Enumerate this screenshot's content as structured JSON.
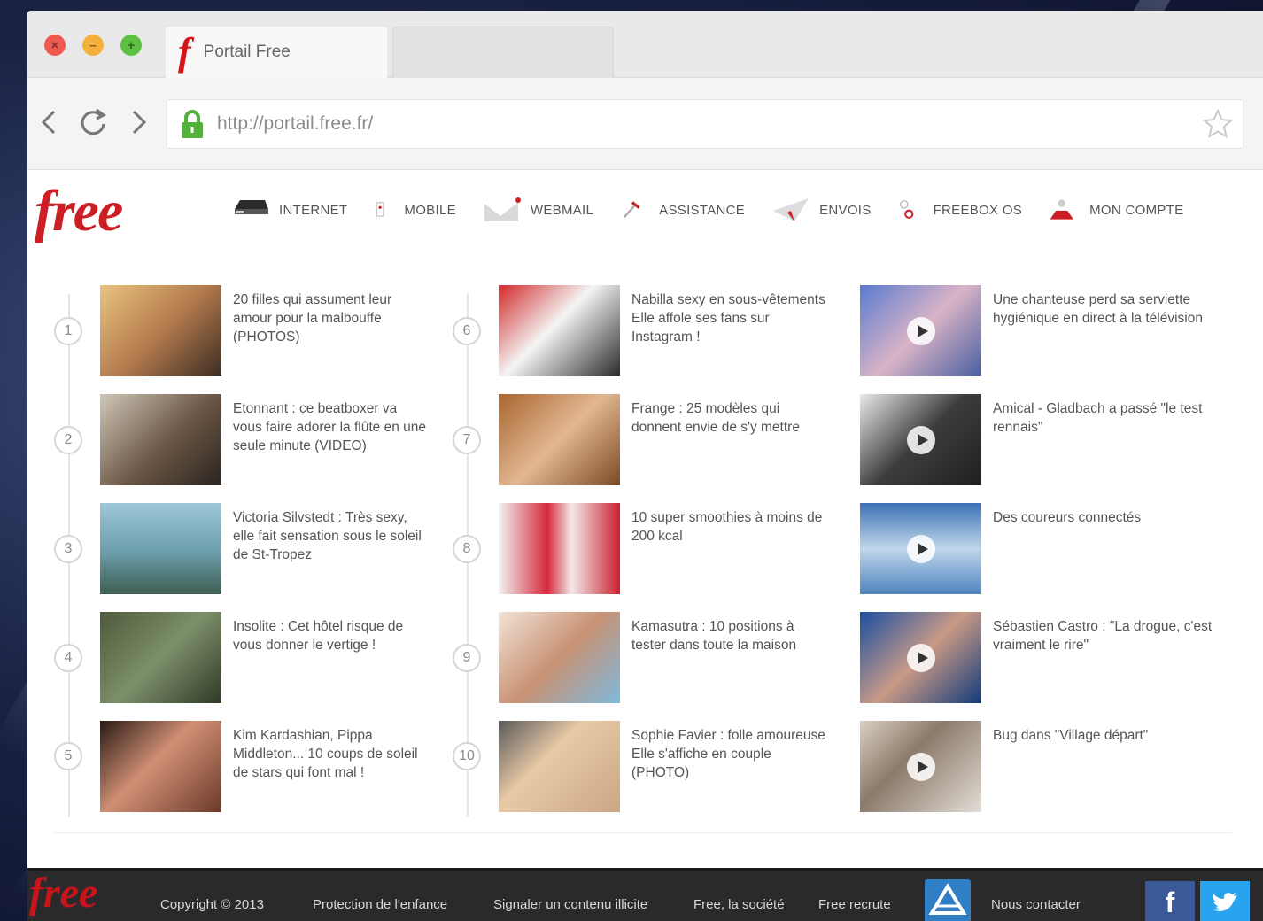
{
  "browser": {
    "tabs": [
      {
        "label": "Portail Free",
        "active": true
      },
      {
        "label": "",
        "active": false
      }
    ],
    "url": "http://portail.free.fr/"
  },
  "site": {
    "logo": "free",
    "nav": [
      {
        "label": "INTERNET",
        "icon": "freebox-icon"
      },
      {
        "label": "MOBILE",
        "icon": "mobile-icon"
      },
      {
        "label": "WEBMAIL",
        "icon": "mail-icon"
      },
      {
        "label": "ASSISTANCE",
        "icon": "tools-icon"
      },
      {
        "label": "ENVOIS",
        "icon": "paper-plane-icon"
      },
      {
        "label": "FREEBOX OS",
        "icon": "freebox-os-icon"
      },
      {
        "label": "MON COMPTE",
        "icon": "user-icon"
      }
    ],
    "ranked_col1": [
      {
        "num": "1",
        "text": "20 filles qui assument leur amour pour la malbouffe (PHOTOS)"
      },
      {
        "num": "2",
        "text": "Etonnant : ce beatboxer va vous faire adorer la flûte en une seule minute (VIDEO)"
      },
      {
        "num": "3",
        "text": "Victoria Silvstedt : Très sexy, elle fait sensation sous le soleil de St-Tropez"
      },
      {
        "num": "4",
        "text": "Insolite : Cet hôtel risque de vous donner le vertige !"
      },
      {
        "num": "5",
        "text": "Kim Kardashian, Pippa Middleton... 10 coups de soleil de stars qui font mal !"
      }
    ],
    "ranked_col2": [
      {
        "num": "6",
        "text": "Nabilla sexy en sous-vêtements Elle affole ses fans sur Instagram !"
      },
      {
        "num": "7",
        "text": "Frange : 25 modèles qui donnent envie de s'y mettre"
      },
      {
        "num": "8",
        "text": "10 super smoothies à moins de 200 kcal"
      },
      {
        "num": "9",
        "text": "Kamasutra : 10 positions à tester dans toute la maison"
      },
      {
        "num": "10",
        "text": "Sophie Favier : folle amoureuse Elle s'affiche en couple (PHOTO)"
      }
    ],
    "videos": [
      {
        "text": "Une chanteuse perd sa serviette hygiénique en direct à la télévision"
      },
      {
        "text": "Amical - Gladbach a passé \"le test rennais\""
      },
      {
        "text": "Des coureurs connectés"
      },
      {
        "text": "Sébastien Castro : \"La drogue, c'est vraiment le rire\""
      },
      {
        "text": "Bug dans \"Village départ\""
      }
    ]
  },
  "footer": {
    "logo": "free",
    "copyright": "Copyright © 2013",
    "links": [
      "Protection de l'enfance",
      "Signaler un contenu illicite",
      "Free, la société",
      "Free recrute",
      "Nous contacter"
    ],
    "social": {
      "facebook": "f"
    }
  },
  "colors": {
    "brand_red": "#cd1e25",
    "footer_bg": "#2a2a2c",
    "facebook": "#3b5998",
    "twitter": "#2aa3ef"
  }
}
